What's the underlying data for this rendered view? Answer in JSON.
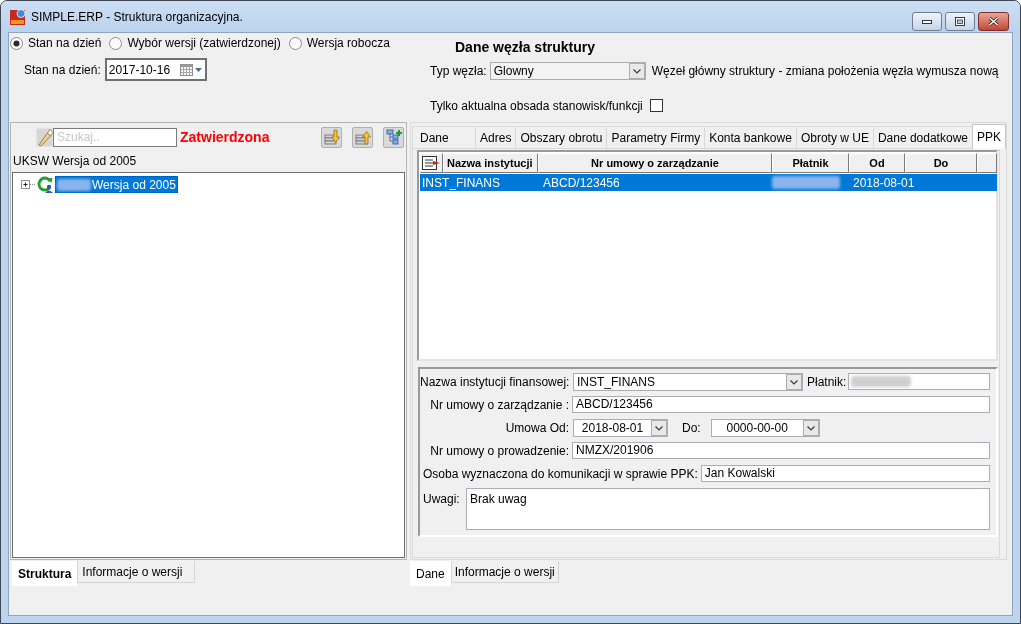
{
  "window": {
    "title": "SIMPLE.ERP - Struktura organizacyjna."
  },
  "version_mode": [
    {
      "label": "Stan na dzień",
      "selected": true
    },
    {
      "label": "Wybór wersji (zatwierdzonej)",
      "selected": false
    },
    {
      "label": "Wersja robocza",
      "selected": false
    }
  ],
  "as_of_date": {
    "label": "Stan na dzień:",
    "value": "2017-10-16"
  },
  "node_details": {
    "title": "Dane węzła struktury",
    "node_type": {
      "label": "Typ węzła:",
      "value": "Glowny",
      "note": "Węzeł główny struktury - zmiana położenia węzła wymusza nową"
    },
    "current_staff_only": {
      "label": "Tylko aktualna obsada stanowisk/funkcji",
      "checked": false
    }
  },
  "structure_panel": {
    "search": {
      "placeholder": "Szukaj.."
    },
    "status": "Zatwierdzona",
    "version_name": "UKSW Wersja od 2005",
    "tree": [
      {
        "label": "Wersja od 2005",
        "expanded": false,
        "selected": true
      }
    ],
    "bottom_tabs": [
      {
        "label": "Struktura",
        "selected": true
      },
      {
        "label": "Informacje o wersji",
        "selected": false
      }
    ]
  },
  "node_panel": {
    "tabs": [
      {
        "label": "Dane",
        "selected": false
      },
      {
        "label": "Adres",
        "selected": false
      },
      {
        "label": "Obszary obrotu",
        "selected": false
      },
      {
        "label": "Parametry Firmy",
        "selected": false
      },
      {
        "label": "Konta bankowe",
        "selected": false
      },
      {
        "label": "Obroty w UE",
        "selected": false
      },
      {
        "label": "Dane dodatkowe",
        "selected": false
      },
      {
        "label": "PPK",
        "selected": true
      }
    ],
    "table": {
      "columns": [
        "Nazwa instytucji",
        "Nr umowy o zarządzanie",
        "Płatnik",
        "Od",
        "Do"
      ],
      "rows": [
        {
          "institution": "INST_FINANS",
          "management_contract": "ABCD/123456",
          "from": "2018-08-01",
          "selected": true
        }
      ]
    },
    "form": {
      "institution": {
        "label": "Nazwa instytucji finansowej:",
        "value": "INST_FINANS"
      },
      "payer": {
        "label": "Płatnik:"
      },
      "management_contract": {
        "label": "Nr umowy o zarządzanie :",
        "value": "ABCD/123456"
      },
      "contract_from": {
        "label": "Umowa Od:",
        "value": "2018-08-01"
      },
      "contract_to": {
        "label": "Do:",
        "value": "0000-00-00"
      },
      "service_contract": {
        "label": "Nr umowy o prowadzenie:",
        "value": "NMZX/201906"
      },
      "contact_person": {
        "label": "Osoba wyznaczona do komunikacji w sprawie PPK:",
        "value": "Jan Kowalski"
      },
      "notes": {
        "label": "Uwagi:",
        "value": "Brak uwag"
      }
    },
    "bottom_tabs": [
      {
        "label": "Dane",
        "selected": true
      },
      {
        "label": "Informacje o wersji",
        "selected": false
      }
    ]
  }
}
